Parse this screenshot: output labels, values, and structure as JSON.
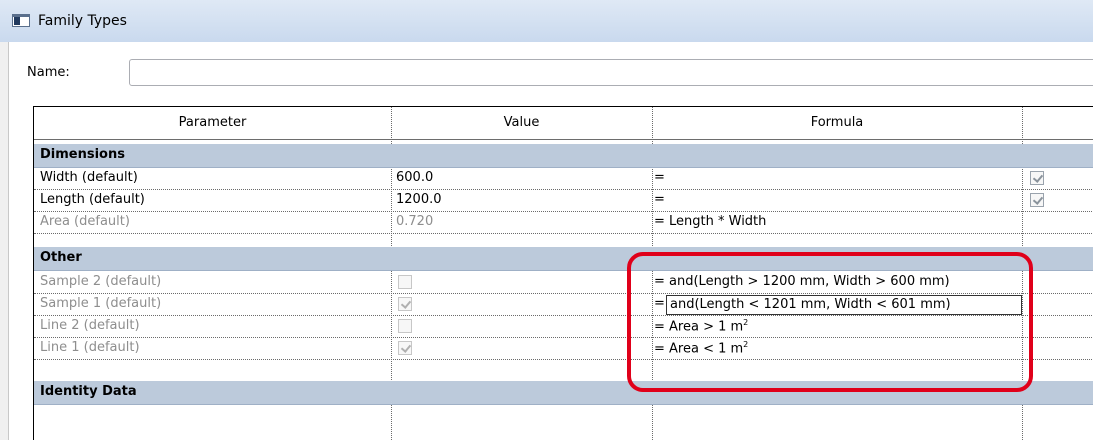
{
  "window": {
    "title": "Family Types"
  },
  "name_field": {
    "label": "Name:",
    "value": ""
  },
  "columns": [
    "Parameter",
    "Value",
    "Formula",
    ""
  ],
  "groups": {
    "dimensions": "Dimensions",
    "other": "Other",
    "identity": "Identity Data"
  },
  "rows": {
    "width": {
      "param": "Width (default)",
      "value": "600.0",
      "formula": "="
    },
    "length": {
      "param": "Length (default)",
      "value": "1200.0",
      "formula": "="
    },
    "area": {
      "param": "Area (default)",
      "value": "0.720",
      "formula": "= Length * Width"
    },
    "sample2": {
      "param": "Sample 2 (default)",
      "checked": false,
      "formula": "= and(Length > 1200 mm, Width > 600 mm)"
    },
    "sample1": {
      "param": "Sample 1 (default)",
      "checked": true,
      "formula_prefix": "=",
      "formula": "and(Length < 1201 mm, Width < 601 mm)"
    },
    "line2": {
      "param": "Line 2 (default)",
      "checked": false,
      "formula": "= Area > 1 m",
      "sup": "2"
    },
    "line1": {
      "param": "Line 1 (default)",
      "checked": true,
      "formula": "= Area < 1 m",
      "sup": "2"
    }
  },
  "highlight_color": "#e0001a"
}
